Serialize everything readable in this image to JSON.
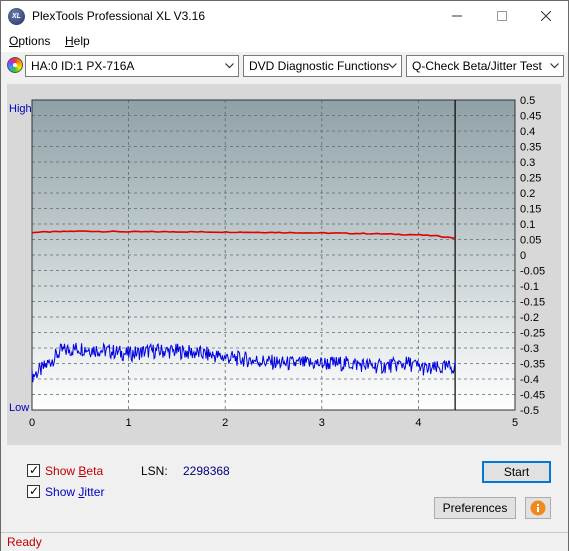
{
  "window": {
    "title": "PlexTools Professional XL V3.16",
    "icon_text": "XL"
  },
  "menu": [
    {
      "label": "Options",
      "mnemonic": "O"
    },
    {
      "label": "Help",
      "mnemonic": "H"
    }
  ],
  "toolbar": {
    "drive": "HA:0 ID:1  PX-716A",
    "function": "DVD Diagnostic Functions",
    "test": "Q-Check Beta/Jitter Test"
  },
  "chart_data": {
    "type": "line",
    "y_left_top_label": "High",
    "y_left_bottom_label": "Low",
    "xlim": [
      0,
      5
    ],
    "x_ticks": [
      "0",
      "1",
      "2",
      "3",
      "4",
      "5"
    ],
    "ylim": [
      -0.5,
      0.5
    ],
    "y_ticks": [
      "0.5",
      "0.45",
      "0.4",
      "0.35",
      "0.3",
      "0.25",
      "0.2",
      "0.15",
      "0.1",
      "0.05",
      "0",
      "-0.05",
      "-0.1",
      "-0.15",
      "-0.2",
      "-0.25",
      "-0.3",
      "-0.35",
      "-0.4",
      "-0.45",
      "-0.5"
    ],
    "marker_x": 4.38,
    "grid": true,
    "series": [
      {
        "name": "Beta",
        "color": "#e00000",
        "x": [
          0.0,
          0.5,
          1.0,
          1.5,
          2.0,
          2.5,
          3.0,
          3.5,
          4.0,
          4.2,
          4.38
        ],
        "values": [
          0.073,
          0.077,
          0.075,
          0.075,
          0.074,
          0.073,
          0.071,
          0.069,
          0.065,
          0.061,
          0.055
        ]
      },
      {
        "name": "Jitter",
        "color": "#0000e0",
        "x": [
          0.0,
          0.1,
          0.2,
          0.3,
          0.5,
          0.8,
          1.0,
          1.2,
          1.5,
          1.8,
          2.0,
          2.3,
          2.6,
          3.0,
          3.3,
          3.6,
          3.9,
          4.1,
          4.38
        ],
        "values": [
          -0.39,
          -0.37,
          -0.34,
          -0.31,
          -0.3,
          -0.31,
          -0.32,
          -0.31,
          -0.31,
          -0.32,
          -0.33,
          -0.34,
          -0.35,
          -0.35,
          -0.35,
          -0.36,
          -0.35,
          -0.37,
          -0.36
        ]
      }
    ]
  },
  "footer": {
    "show_beta_label": "Show Beta",
    "show_jitter_label": "Show Jitter",
    "lsn_label": "LSN:",
    "lsn_value": "2298368",
    "start_label": "Start",
    "preferences_label": "Preferences",
    "beta_color": "#c00000",
    "jitter_color": "#0000c0"
  },
  "status": {
    "text": "Ready"
  }
}
